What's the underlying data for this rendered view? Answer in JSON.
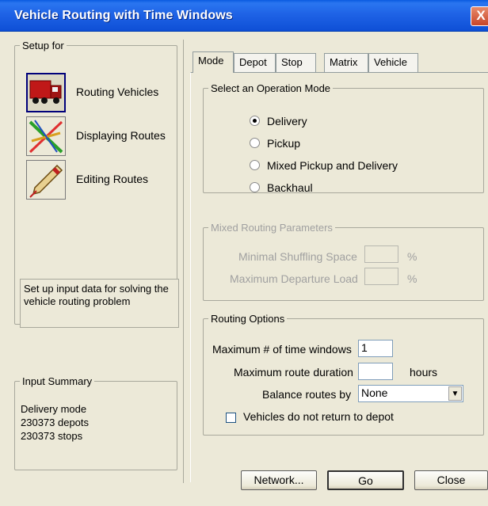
{
  "window": {
    "title": "Vehicle Routing with Time Windows",
    "close_glyph": "X"
  },
  "setup": {
    "legend": "Setup for",
    "modes": [
      {
        "label": "Routing Vehicles",
        "icon": "truck-icon",
        "active": true
      },
      {
        "label": "Displaying Routes",
        "icon": "routes-icon",
        "active": false
      },
      {
        "label": "Editing Routes",
        "icon": "pencil-icon",
        "active": false
      }
    ],
    "description": "Set up input data for solving the vehicle routing problem"
  },
  "input_summary": {
    "legend": "Input Summary",
    "lines": [
      "Delivery mode",
      "230373 depots",
      "230373 stops"
    ]
  },
  "tabs": [
    "Mode",
    "Depot",
    "Stop",
    "Matrix",
    "Vehicle"
  ],
  "active_tab": "Mode",
  "operation_mode": {
    "legend": "Select an Operation Mode",
    "options": [
      "Delivery",
      "Pickup",
      "Mixed Pickup and Delivery",
      "Backhaul"
    ],
    "selected": "Delivery"
  },
  "mixed_params": {
    "legend": "Mixed Routing Parameters",
    "minimal_shuffling_label": "Minimal Shuffling Space",
    "minimal_shuffling_value": "",
    "minimal_shuffling_unit": "%",
    "max_departure_label": "Maximum Departure Load",
    "max_departure_value": "",
    "max_departure_unit": "%"
  },
  "routing_options": {
    "legend": "Routing Options",
    "max_time_windows_label": "Maximum # of time windows",
    "max_time_windows_value": "1",
    "max_route_duration_label": "Maximum route duration",
    "max_route_duration_value": "",
    "max_route_duration_unit": "hours",
    "balance_label": "Balance routes by",
    "balance_value": "None",
    "no_return_label": "Vehicles do not return to depot",
    "no_return_checked": false
  },
  "buttons": {
    "network": "Network...",
    "go": "Go",
    "close": "Close"
  }
}
